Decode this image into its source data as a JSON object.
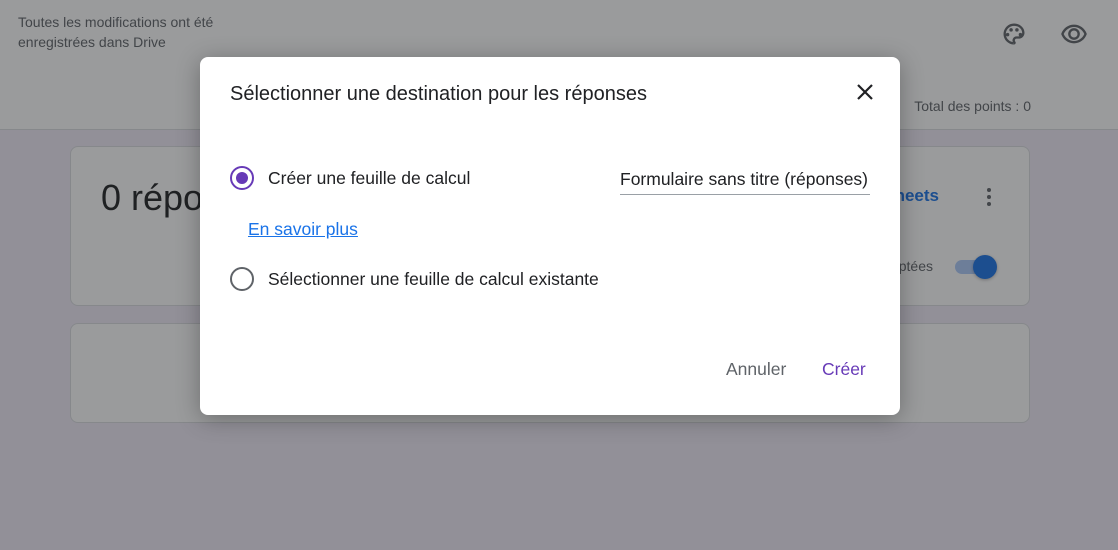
{
  "header": {
    "save_status": "Toutes les modifications ont été enregistrées dans Drive",
    "total_points": "Total des points : 0",
    "icons": [
      "palette-icon",
      "eye-icon"
    ]
  },
  "summary_card": {
    "responses_count": "0 répo",
    "sheets_link": "heets",
    "accepting_label": "ptées",
    "accepting_toggle": true
  },
  "dialog": {
    "title": "Sélectionner une destination pour les réponses",
    "options": [
      {
        "label": "Créer une feuille de calcul",
        "checked": true
      },
      {
        "label": "Sélectionner une feuille de calcul existante",
        "checked": false
      }
    ],
    "sheet_name_value": "Formulaire sans titre (réponses)",
    "learn_more": "En savoir plus",
    "cancel_label": "Annuler",
    "create_label": "Créer"
  },
  "colors": {
    "accent": "#673ab7",
    "link": "#1a73e8",
    "background": "#f0ebf8"
  }
}
